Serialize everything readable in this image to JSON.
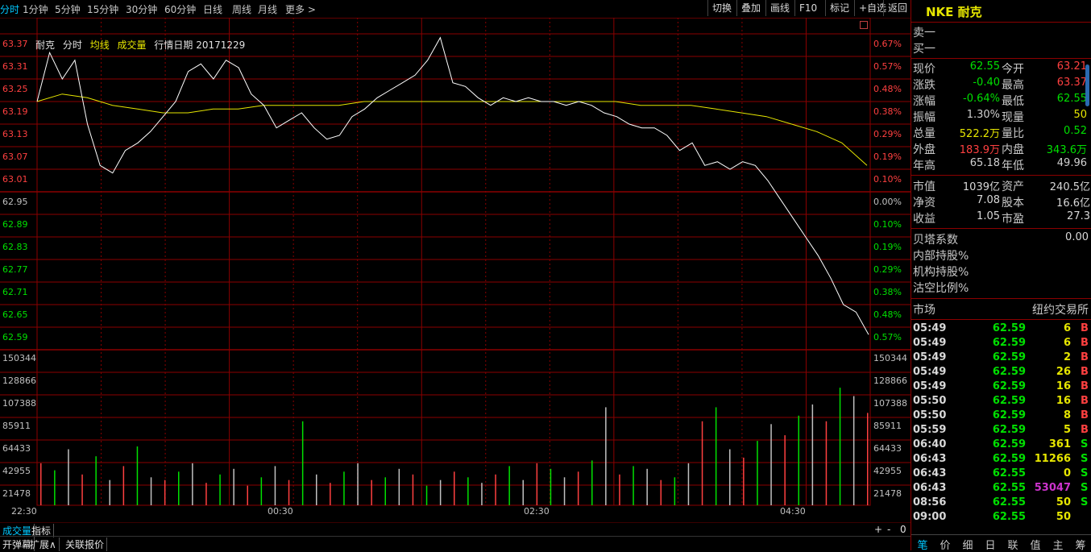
{
  "period_tabs": [
    "分时",
    "1分钟",
    "5分钟",
    "15分钟",
    "30分钟",
    "60分钟",
    "日线",
    "周线",
    "月线",
    "更多 >"
  ],
  "toolbar": [
    "切换",
    "叠加",
    "画线",
    "F10",
    "标记",
    "+自选",
    "返回"
  ],
  "info": {
    "name": "耐克",
    "mode": "分时",
    "avg_label": "均线",
    "vol_label": "成交量",
    "date_label": "行情日期 20171229"
  },
  "colors": {
    "up": "#ff4040",
    "down": "#00e000",
    "neutral": "#c0c0c0",
    "avg": "#e6e600",
    "grid": "#8b0000",
    "price_line": "#ffffff"
  },
  "price_axis_left": [
    "63.37",
    "63.31",
    "63.25",
    "63.19",
    "63.13",
    "63.07",
    "63.01",
    "62.95",
    "62.89",
    "62.83",
    "62.77",
    "62.71",
    "62.65",
    "62.59"
  ],
  "price_axis_right": [
    "0.67%",
    "0.57%",
    "0.48%",
    "0.38%",
    "0.29%",
    "0.19%",
    "0.10%",
    "0.00%",
    "0.10%",
    "0.19%",
    "0.29%",
    "0.38%",
    "0.48%",
    "0.57%"
  ],
  "volume_axis": [
    "150344",
    "128866",
    "107388",
    "85911",
    "64433",
    "42955",
    "21478"
  ],
  "time_axis": [
    "22:30",
    "00:30",
    "02:30",
    "04:30"
  ],
  "bottom_tabs": [
    "成交量",
    "指标"
  ],
  "bottom_bar": [
    "开弹幕",
    "扩展∧",
    "关联报价"
  ],
  "chart_controls": [
    "+",
    "-",
    "0"
  ],
  "chart_data": {
    "type": "line",
    "title": "",
    "xlabel": "",
    "ylabel": "",
    "ylim": [
      62.53,
      63.37
    ],
    "x_ticks": [
      "22:30",
      "00:30",
      "02:30",
      "04:30"
    ],
    "series": [
      {
        "name": "",
        "values": [
          63.19,
          63.32,
          63.25,
          63.3,
          63.13,
          63.02,
          63.0,
          63.06,
          63.08,
          63.11,
          63.15,
          63.19,
          63.27,
          63.29,
          63.25,
          63.3,
          63.28,
          63.21,
          63.18,
          63.12,
          63.14,
          63.16,
          63.12,
          63.09,
          63.1,
          63.15,
          63.17,
          63.2,
          63.22,
          63.24,
          63.26,
          63.3,
          63.36,
          63.24,
          63.23,
          63.2,
          63.18,
          63.2,
          63.19,
          63.2,
          63.19,
          63.19,
          63.18,
          63.19,
          63.18,
          63.16,
          63.15,
          63.13,
          63.12,
          63.12,
          63.1,
          63.06,
          63.08,
          63.02,
          63.03,
          63.01,
          63.03,
          63.02,
          62.98,
          62.93,
          62.88,
          62.83,
          62.78,
          62.72,
          62.65,
          62.63,
          62.57
        ]
      },
      {
        "name": "均线",
        "values": [
          63.19,
          63.21,
          63.2,
          63.18,
          63.17,
          63.16,
          63.16,
          63.17,
          63.17,
          63.18,
          63.18,
          63.18,
          63.18,
          63.19,
          63.19,
          63.19,
          63.19,
          63.19,
          63.19,
          63.19,
          63.19,
          63.19,
          63.19,
          63.19,
          63.18,
          63.18,
          63.18,
          63.17,
          63.16,
          63.15,
          63.13,
          63.11,
          63.08,
          63.02
        ]
      }
    ],
    "volume": [
      30,
      25,
      40,
      22,
      35,
      18,
      28,
      42,
      20,
      18,
      24,
      30,
      16,
      22,
      26,
      14,
      20,
      28,
      18,
      60,
      22,
      16,
      24,
      30,
      18,
      20,
      26,
      22,
      14,
      18,
      24,
      20,
      16,
      22,
      28,
      18,
      30,
      26,
      20,
      24,
      32,
      70,
      22,
      28,
      26,
      18,
      20,
      30,
      60,
      70,
      40,
      34,
      46,
      58,
      50,
      64,
      72,
      60,
      84,
      78,
      66
    ]
  },
  "right_panel": {
    "title_code": "NKE",
    "title_name": "耐克",
    "sell1": "卖一",
    "buy1": "买一",
    "quote_rows": [
      [
        {
          "l": "现价",
          "v": "62.55",
          "c": "#00e000"
        },
        {
          "l": "今开",
          "v": "63.21",
          "c": "#ff4040"
        }
      ],
      [
        {
          "l": "涨跌",
          "v": "-0.40",
          "c": "#00e000"
        },
        {
          "l": "最高",
          "v": "63.37",
          "c": "#ff4040"
        }
      ],
      [
        {
          "l": "涨幅",
          "v": "-0.64%",
          "c": "#00e000"
        },
        {
          "l": "最低",
          "v": "62.55",
          "c": "#00e000"
        }
      ],
      [
        {
          "l": "振幅",
          "v": "1.30%",
          "c": "#d0d0d0"
        },
        {
          "l": "现量",
          "v": "50",
          "c": "#e6e600"
        }
      ],
      [
        {
          "l": "总量",
          "v": "522.2万",
          "c": "#e6e600"
        },
        {
          "l": "量比",
          "v": "0.52",
          "c": "#00e000"
        }
      ],
      [
        {
          "l": "外盘",
          "v": "183.9万",
          "c": "#ff4040"
        },
        {
          "l": "内盘",
          "v": "343.6万",
          "c": "#00e000"
        }
      ],
      [
        {
          "l": "年高",
          "v": "65.18",
          "c": "#d0d0d0"
        },
        {
          "l": "年低",
          "v": "49.96",
          "c": "#d0d0d0"
        }
      ]
    ],
    "fund_rows": [
      [
        {
          "l": "市值",
          "v": "1039亿"
        },
        {
          "l": "资产",
          "v": "240.5亿"
        }
      ],
      [
        {
          "l": "净资",
          "v": "7.08"
        },
        {
          "l": "股本",
          "v": "16.6亿"
        }
      ],
      [
        {
          "l": "收益",
          "v": "1.05"
        },
        {
          "l": "市盈",
          "v": "27.3"
        }
      ]
    ],
    "extra_rows": [
      {
        "l": "贝塔系数",
        "v": "0.00"
      },
      {
        "l": "内部持股%",
        "v": ""
      },
      {
        "l": "机构持股%",
        "v": ""
      },
      {
        "l": "沽空比例%",
        "v": ""
      }
    ],
    "market_label": "市场",
    "market_value": "纽约交易所",
    "ticks": [
      {
        "t": "05:49",
        "p": "62.59",
        "q": "6",
        "qc": "#e6e600",
        "s": "B"
      },
      {
        "t": "05:49",
        "p": "62.59",
        "q": "6",
        "qc": "#e6e600",
        "s": "B"
      },
      {
        "t": "05:49",
        "p": "62.59",
        "q": "2",
        "qc": "#e6e600",
        "s": "B"
      },
      {
        "t": "05:49",
        "p": "62.59",
        "q": "26",
        "qc": "#e6e600",
        "s": "B"
      },
      {
        "t": "05:49",
        "p": "62.59",
        "q": "16",
        "qc": "#e6e600",
        "s": "B"
      },
      {
        "t": "05:50",
        "p": "62.59",
        "q": "16",
        "qc": "#e6e600",
        "s": "B"
      },
      {
        "t": "05:50",
        "p": "62.59",
        "q": "8",
        "qc": "#e6e600",
        "s": "B"
      },
      {
        "t": "05:59",
        "p": "62.59",
        "q": "5",
        "qc": "#e6e600",
        "s": "B"
      },
      {
        "t": "06:40",
        "p": "62.59",
        "q": "361",
        "qc": "#e6e600",
        "s": "S"
      },
      {
        "t": "06:43",
        "p": "62.59",
        "q": "11266",
        "qc": "#e6e600",
        "s": "S"
      },
      {
        "t": "06:43",
        "p": "62.55",
        "q": "0",
        "qc": "#e6e600",
        "s": "S"
      },
      {
        "t": "06:43",
        "p": "62.55",
        "q": "53047",
        "qc": "#cc33cc",
        "s": "S"
      },
      {
        "t": "08:56",
        "p": "62.55",
        "q": "50",
        "qc": "#e6e600",
        "s": "S"
      },
      {
        "t": "09:00",
        "p": "62.55",
        "q": "50",
        "qc": "#e6e600",
        "s": ""
      }
    ],
    "bottom_tabs": [
      "笔",
      "价",
      "细",
      "日",
      "联",
      "值",
      "主",
      "筹"
    ]
  }
}
